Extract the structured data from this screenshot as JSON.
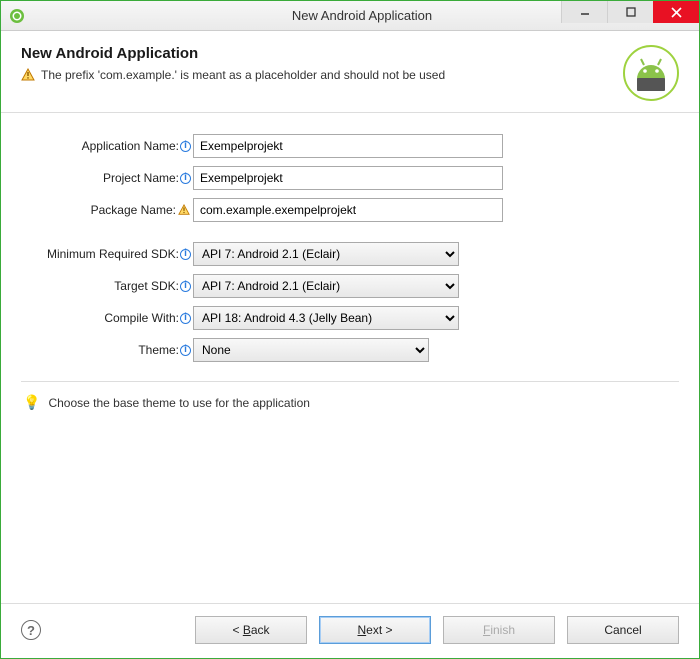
{
  "window": {
    "title": "New Android Application"
  },
  "header": {
    "title": "New Android Application",
    "warning": "The prefix 'com.example.' is meant as a placeholder and should not be used"
  },
  "form": {
    "appName": {
      "label": "Application Name:",
      "value": "Exempelprojekt"
    },
    "projName": {
      "label": "Project Name:",
      "value": "Exempelprojekt"
    },
    "pkgName": {
      "label": "Package Name:",
      "value": "com.example.exempelprojekt"
    },
    "minSdk": {
      "label": "Minimum Required SDK:",
      "value": "API 7: Android 2.1 (Eclair)"
    },
    "tgtSdk": {
      "label": "Target SDK:",
      "value": "API 7: Android 2.1 (Eclair)"
    },
    "compile": {
      "label": "Compile With:",
      "value": "API 18: Android 4.3 (Jelly Bean)"
    },
    "theme": {
      "label": "Theme:",
      "value": "None"
    }
  },
  "hint": "Choose the base theme to use for the application",
  "buttons": {
    "back": "< Back",
    "next": "Next >",
    "finish": "Finish",
    "cancel": "Cancel"
  }
}
